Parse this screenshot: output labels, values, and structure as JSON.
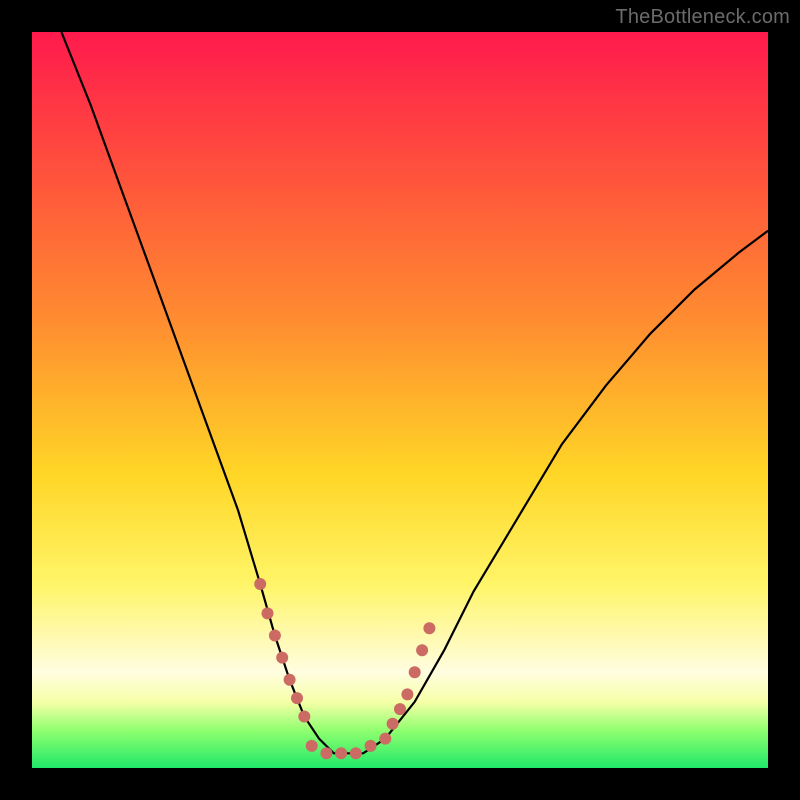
{
  "watermark": "TheBottleneck.com",
  "chart_data": {
    "type": "line",
    "title": "",
    "xlabel": "",
    "ylabel": "",
    "xlim": [
      0,
      100
    ],
    "ylim": [
      0,
      100
    ],
    "grid": false,
    "legend": false,
    "series": [
      {
        "name": "curve",
        "x": [
          4,
          8,
          12,
          16,
          20,
          24,
          28,
          31,
          33,
          35,
          37,
          39,
          41,
          43,
          45,
          48,
          52,
          56,
          60,
          66,
          72,
          78,
          84,
          90,
          96,
          100
        ],
        "values": [
          100,
          90,
          79,
          68,
          57,
          46,
          35,
          25,
          18,
          12,
          7,
          4,
          2,
          2,
          2,
          4,
          9,
          16,
          24,
          34,
          44,
          52,
          59,
          65,
          70,
          73
        ]
      }
    ],
    "annotations": [
      {
        "type": "dots",
        "name": "left-dotted-segment",
        "color": "#cc6b63",
        "x": [
          31,
          32,
          33,
          34,
          35,
          36,
          37
        ],
        "y": [
          25,
          21,
          18,
          15,
          12,
          9.5,
          7
        ]
      },
      {
        "type": "dots",
        "name": "bottom-dotted-segment",
        "color": "#cc6b63",
        "x": [
          38,
          40,
          42,
          44,
          46,
          48
        ],
        "y": [
          3,
          2,
          2,
          2,
          3,
          4
        ]
      },
      {
        "type": "dots",
        "name": "right-dotted-segment",
        "color": "#cc6b63",
        "x": [
          49,
          50,
          51,
          52,
          53,
          54
        ],
        "y": [
          6,
          8,
          10,
          13,
          16,
          19
        ]
      }
    ],
    "colors": {
      "curve": "#000000",
      "dots": "#cc6b63",
      "background_top": "#ff1a4d",
      "background_bottom": "#20e86a",
      "frame": "#000000"
    }
  }
}
